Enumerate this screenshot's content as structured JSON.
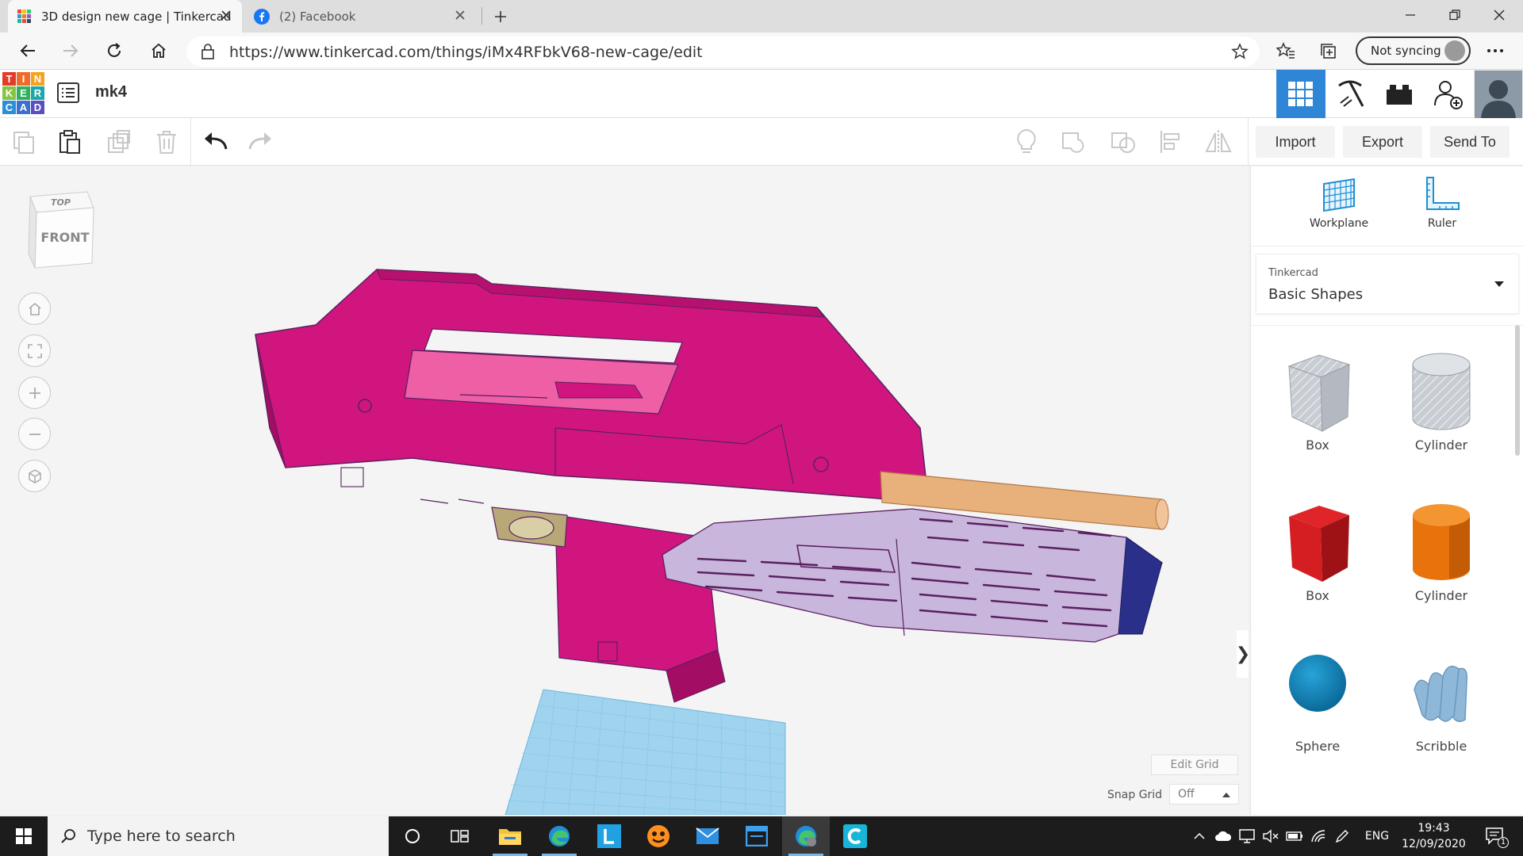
{
  "browser": {
    "tabs": [
      {
        "title": "3D design new cage | Tinkercad",
        "active": true
      },
      {
        "title": "(2) Facebook",
        "active": false
      }
    ],
    "url": "https://www.tinkercad.com/things/iMx4RFbkV68-new-cage/edit",
    "sync_label": "Not syncing"
  },
  "header": {
    "logo_letters": [
      "T",
      "I",
      "N",
      "K",
      "E",
      "R",
      "C",
      "A",
      "D"
    ],
    "design_name": "mk4"
  },
  "toolbar": {
    "import_label": "Import",
    "export_label": "Export",
    "send_to_label": "Send To"
  },
  "viewcube": {
    "top_label": "TOP",
    "front_label": "FRONT"
  },
  "workspace": {
    "edit_grid_label": "Edit Grid",
    "snap_grid_label": "Snap Grid",
    "snap_grid_value": "Off"
  },
  "right_panel": {
    "workplane_label": "Workplane",
    "ruler_label": "Ruler",
    "library_provider": "Tinkercad",
    "library_name": "Basic Shapes",
    "shapes": [
      {
        "label": "Box",
        "icon": "box-hole-icon"
      },
      {
        "label": "Cylinder",
        "icon": "cylinder-hole-icon"
      },
      {
        "label": "Box",
        "icon": "box-solid-icon"
      },
      {
        "label": "Cylinder",
        "icon": "cylinder-solid-icon"
      },
      {
        "label": "Sphere",
        "icon": "sphere-icon"
      },
      {
        "label": "Scribble",
        "icon": "scribble-icon"
      }
    ]
  },
  "taskbar": {
    "search_placeholder": "Type here to search",
    "language": "ENG",
    "time": "19:43",
    "date": "12/09/2020",
    "notification_count": "1"
  },
  "colors": {
    "model_magenta": "#d1157f",
    "model_lavender": "#c9b6dc",
    "model_barrel": "#e8b07a",
    "workplane_blue": "#9fd3ee",
    "grid_active": "#2f86d6"
  }
}
